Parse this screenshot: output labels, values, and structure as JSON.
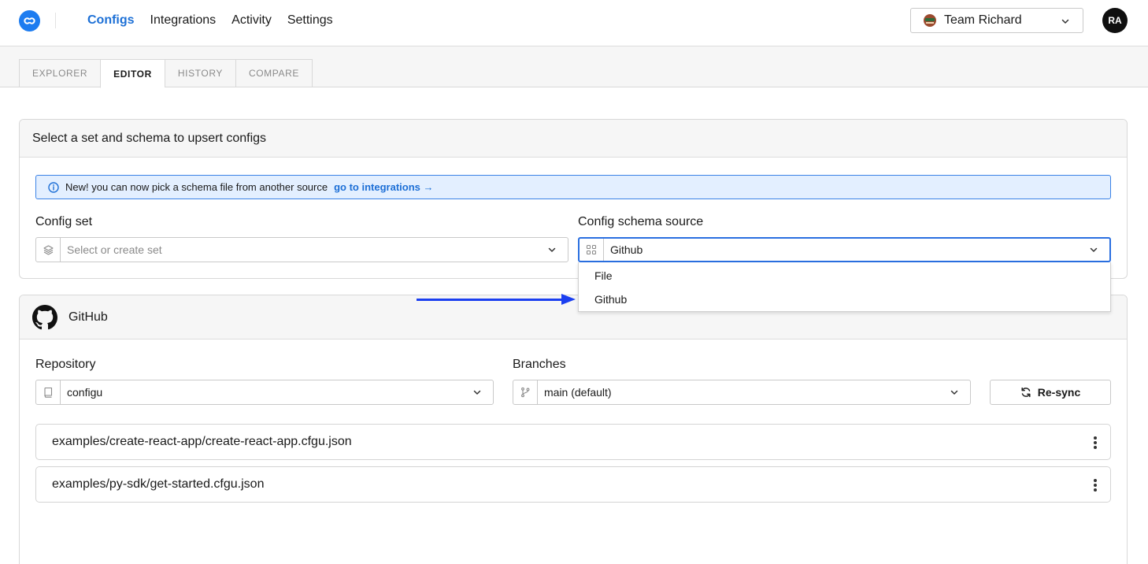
{
  "nav": {
    "items": [
      {
        "label": "Configs",
        "active": true
      },
      {
        "label": "Integrations",
        "active": false
      },
      {
        "label": "Activity",
        "active": false
      },
      {
        "label": "Settings",
        "active": false
      }
    ]
  },
  "team": {
    "label": "Team Richard"
  },
  "user": {
    "initials": "RA"
  },
  "tabs": [
    "EXPLORER",
    "EDITOR",
    "HISTORY",
    "COMPARE"
  ],
  "active_tab": "EDITOR",
  "editor": {
    "card_title": "Select a set and schema to upsert configs",
    "notice": {
      "text": "New! you can now pick a schema file from another source",
      "link": "go to integrations →"
    },
    "config_set": {
      "label": "Config set",
      "placeholder": "Select or create set"
    },
    "schema_source": {
      "label": "Config schema source",
      "value": "Github",
      "options": [
        "File",
        "Github"
      ]
    }
  },
  "github": {
    "title": "GitHub",
    "repository": {
      "label": "Repository",
      "value": "configu"
    },
    "branches": {
      "label": "Branches",
      "value": "main (default)"
    },
    "resync_label": "Re-sync",
    "files": [
      "examples/create-react-app/create-react-app.cfgu.json",
      "examples/py-sdk/get-started.cfgu.json"
    ]
  },
  "colors": {
    "accent": "#1d70d6",
    "annotation_arrow": "#1b3ff0"
  }
}
